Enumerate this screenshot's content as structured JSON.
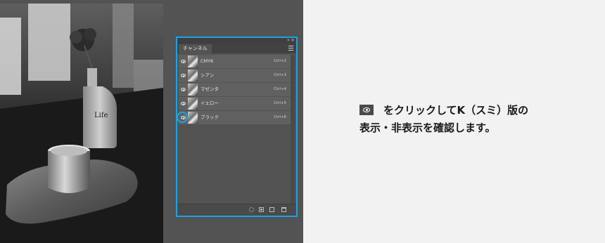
{
  "panel": {
    "tab_label": "チャンネル",
    "channels": [
      {
        "name": "CMYK",
        "shortcut": "Ctrl+2",
        "visible": true
      },
      {
        "name": "シアン",
        "shortcut": "Ctrl+3",
        "visible": true
      },
      {
        "name": "マゼンタ",
        "shortcut": "Ctrl+4",
        "visible": true
      },
      {
        "name": "イエロー",
        "shortcut": "Ctrl+5",
        "visible": true
      },
      {
        "name": "ブラック",
        "shortcut": "Ctrl+6",
        "visible": true,
        "highlighted": true
      }
    ],
    "bottom_icons": [
      "load-selection-icon",
      "save-selection-icon",
      "new-channel-icon",
      "delete-channel-icon"
    ],
    "highlight_color": "#1fa2e0"
  },
  "instruction": {
    "line1_after_icon": "をクリックしてK（スミ）版の",
    "line2": "表示・非表示を確認します。",
    "icon": "eye-icon"
  },
  "photo": {
    "label_text": "Life"
  }
}
